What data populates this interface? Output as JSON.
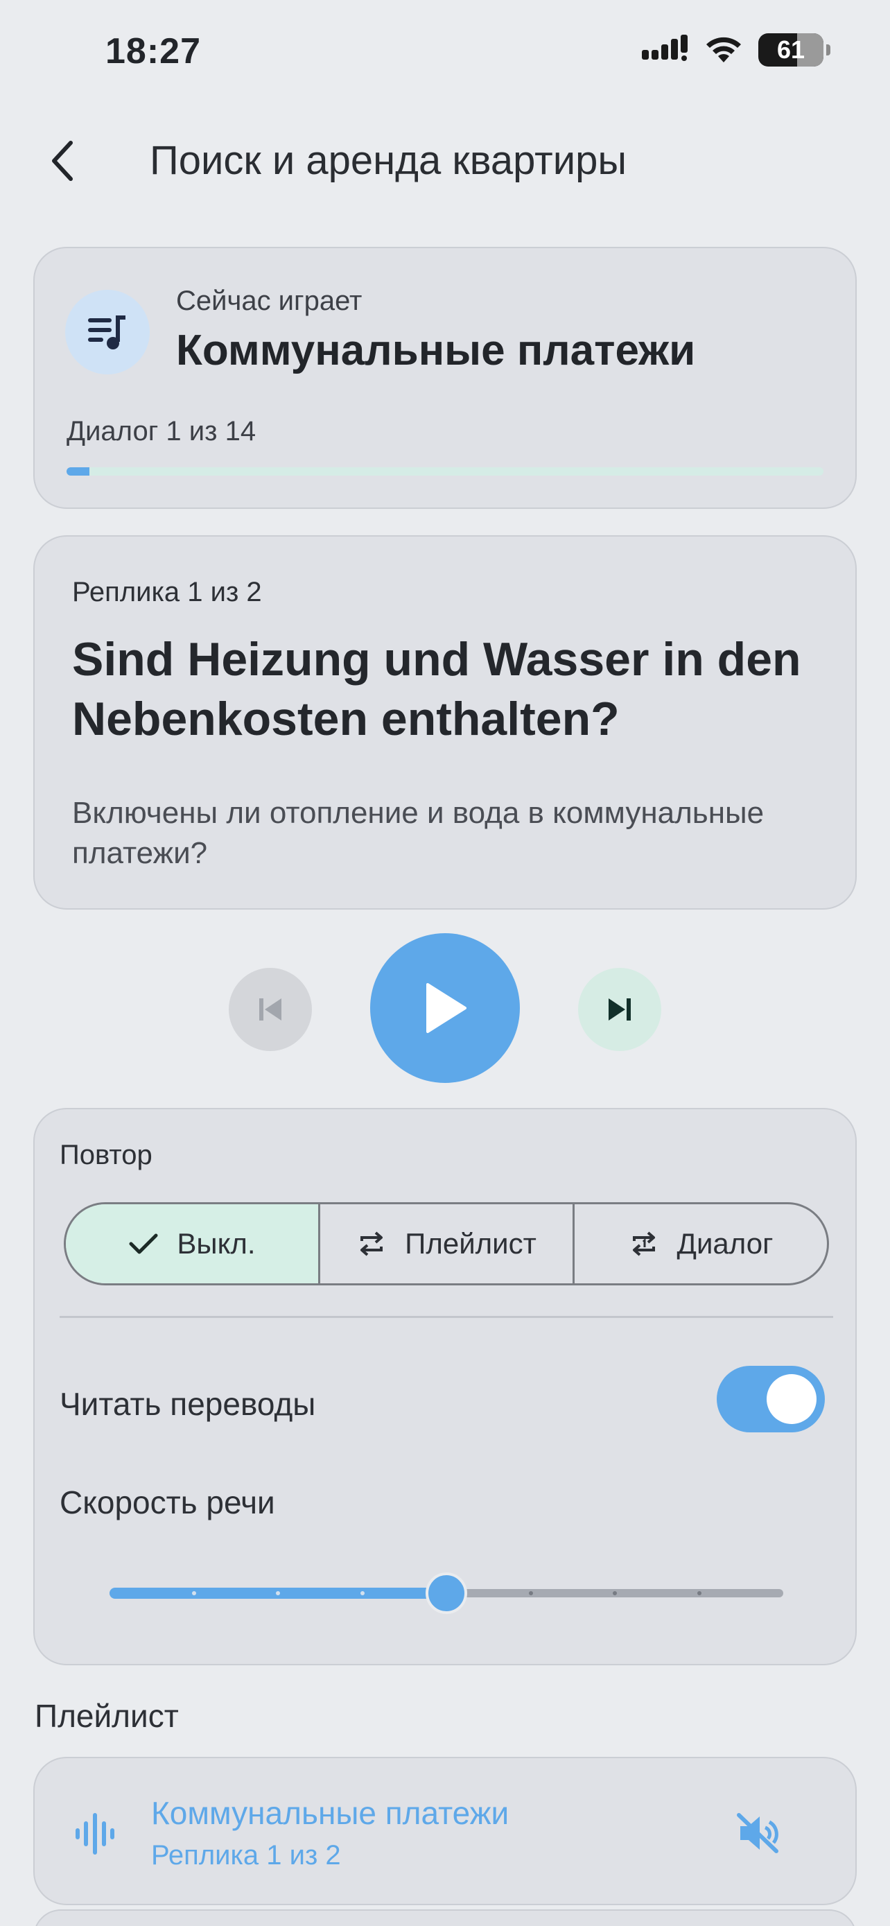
{
  "status_bar": {
    "time": "18:27",
    "battery": "61"
  },
  "header": {
    "title": "Поиск и аренда квартиры"
  },
  "now_playing": {
    "label": "Сейчас играет",
    "title": "Коммунальные платежи",
    "progress_label": "Диалог 1 из 14",
    "progress_fraction": 0.03
  },
  "phrase": {
    "counter": "Реплика 1 из 2",
    "german": "Sind Heizung und Wasser in den Nebenkosten enthalten?",
    "russian": "Включены ли отопление и вода в коммунальные платежи?"
  },
  "settings": {
    "repeat_label": "Повтор",
    "repeat_options": [
      "Выкл.",
      "Плейлист",
      "Диалог"
    ],
    "repeat_selected": 0,
    "read_translations_label": "Читать переводы",
    "read_translations_on": true,
    "speech_speed_label": "Скорость речи",
    "speech_speed_steps": 9,
    "speech_speed_index": 4
  },
  "playlist": {
    "heading": "Плейлист",
    "items": [
      {
        "title": "Коммунальные платежи",
        "subtitle": "Реплика 1 из 2"
      }
    ]
  },
  "colors": {
    "accent": "#5ea8e9",
    "background": "#eaecef",
    "card": "#dfe1e6",
    "active_segment": "#d6efe6"
  }
}
